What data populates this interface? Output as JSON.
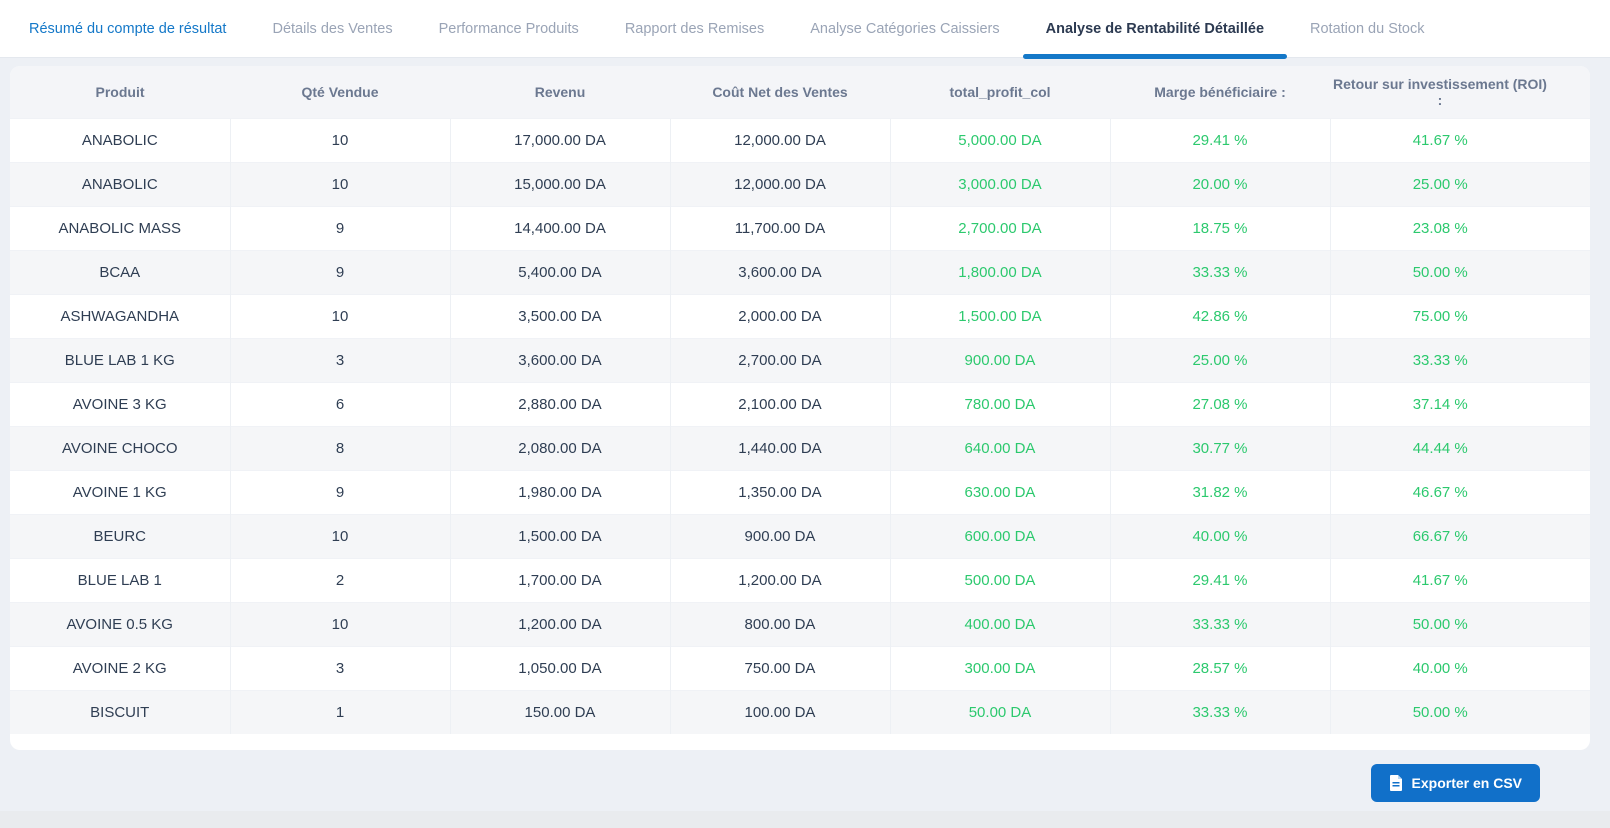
{
  "tabs": [
    {
      "name": "resume-compte-resultat",
      "label": "Résumé du compte de résultat",
      "state": "highlight"
    },
    {
      "name": "details-des-ventes",
      "label": "Détails des Ventes",
      "state": ""
    },
    {
      "name": "performance-produits",
      "label": "Performance Produits",
      "state": ""
    },
    {
      "name": "rapport-des-remises",
      "label": "Rapport des Remises",
      "state": ""
    },
    {
      "name": "analyse-categories-caissiers",
      "label": "Analyse Catégories Caissiers",
      "state": ""
    },
    {
      "name": "analyse-rentabilite-detaillee",
      "label": "Analyse de Rentabilité Détaillée",
      "state": "active"
    },
    {
      "name": "rotation-du-stock",
      "label": "Rotation du Stock",
      "state": ""
    }
  ],
  "table": {
    "columns": [
      "Produit",
      "Qté Vendue",
      "Revenu",
      "Coût Net des Ventes",
      "total_profit_col",
      "Marge bénéficiaire :",
      "Retour sur investissement (ROI) :"
    ],
    "rows": [
      [
        "ANABOLIC",
        "10",
        "17,000.00 DA",
        "12,000.00 DA",
        "5,000.00 DA",
        "29.41 %",
        "41.67 %"
      ],
      [
        "ANABOLIC",
        "10",
        "15,000.00 DA",
        "12,000.00 DA",
        "3,000.00 DA",
        "20.00 %",
        "25.00 %"
      ],
      [
        "ANABOLIC MASS",
        "9",
        "14,400.00 DA",
        "11,700.00 DA",
        "2,700.00 DA",
        "18.75 %",
        "23.08 %"
      ],
      [
        "BCAA",
        "9",
        "5,400.00 DA",
        "3,600.00 DA",
        "1,800.00 DA",
        "33.33 %",
        "50.00 %"
      ],
      [
        "ASHWAGANDHA",
        "10",
        "3,500.00 DA",
        "2,000.00 DA",
        "1,500.00 DA",
        "42.86 %",
        "75.00 %"
      ],
      [
        "BLUE LAB 1 KG",
        "3",
        "3,600.00 DA",
        "2,700.00 DA",
        "900.00 DA",
        "25.00 %",
        "33.33 %"
      ],
      [
        "AVOINE 3 KG",
        "6",
        "2,880.00 DA",
        "2,100.00 DA",
        "780.00 DA",
        "27.08 %",
        "37.14 %"
      ],
      [
        "AVOINE CHOCO",
        "8",
        "2,080.00 DA",
        "1,440.00 DA",
        "640.00 DA",
        "30.77 %",
        "44.44 %"
      ],
      [
        "AVOINE 1 KG",
        "9",
        "1,980.00 DA",
        "1,350.00 DA",
        "630.00 DA",
        "31.82 %",
        "46.67 %"
      ],
      [
        "BEURC",
        "10",
        "1,500.00 DA",
        "900.00 DA",
        "600.00 DA",
        "40.00 %",
        "66.67 %"
      ],
      [
        "BLUE LAB 1",
        "2",
        "1,700.00 DA",
        "1,200.00 DA",
        "500.00 DA",
        "29.41 %",
        "41.67 %"
      ],
      [
        "AVOINE 0.5 KG",
        "10",
        "1,200.00 DA",
        "800.00 DA",
        "400.00 DA",
        "33.33 %",
        "50.00 %"
      ],
      [
        "AVOINE 2 KG",
        "3",
        "1,050.00 DA",
        "750.00 DA",
        "300.00 DA",
        "28.57 %",
        "40.00 %"
      ],
      [
        "BISCUIT",
        "1",
        "150.00 DA",
        "100.00 DA",
        "50.00 DA",
        "33.33 %",
        "50.00 %"
      ]
    ]
  },
  "export_button": {
    "label": "Exporter en CSV",
    "icon": "file-csv-icon"
  },
  "colors": {
    "accent_blue": "#1478c8",
    "button_blue": "#1170c9",
    "profit_green": "#2cc96e",
    "text_dark": "#2f3e53",
    "text_muted": "#9aa4b6",
    "header_text": "#6b7890",
    "row_stripe": "#f5f6f8",
    "page_bg": "#edf0f5"
  }
}
